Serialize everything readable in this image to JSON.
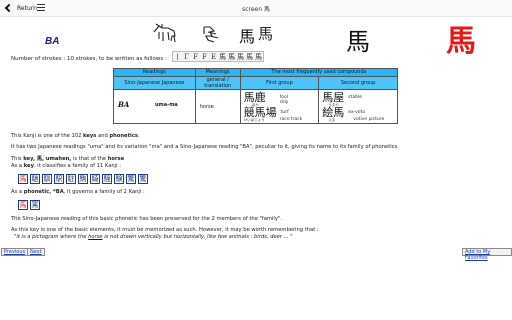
{
  "header": {
    "back_label": "Return",
    "title": "screen 馬"
  },
  "hero": {
    "reading": "BA",
    "stroke_order": [
      "丨",
      "Γ",
      "F",
      "F",
      "E",
      "馬",
      "馬",
      "馬",
      "馬",
      "馬"
    ],
    "kanji_old_1": "馬",
    "kanji_old_2": "馬",
    "kanji_display_black": "馬",
    "kanji_display_red": "馬"
  },
  "strokes_text": "Number of strokes : 10 strokes, to be written as follows :",
  "table": {
    "headers": {
      "readings": "Readings",
      "meanings": "Meanings",
      "compounds": "The most frequently used compounds"
    },
    "subheaders": {
      "readings": "Sino-Japanese    Japanese",
      "meanings": "general / translation",
      "first_group": "First group",
      "second_group": "Second group"
    },
    "row": {
      "sino": "BA",
      "japanese": "uma-ma",
      "meaning": "horse",
      "first_group": [
        {
          "kanji": "馬鹿",
          "meaning": "fool",
          "reading": "ばか"
        },
        {
          "kanji": "",
          "meaning": "silly",
          "reading": ""
        },
        {
          "kanji": "競馬場",
          "meaning": "turf",
          "reading": "けいばじょう"
        },
        {
          "kanji": "",
          "meaning": "race track",
          "reading": ""
        }
      ],
      "second_group": [
        {
          "kanji": "馬屋",
          "meaning": "stable",
          "reading": "うまや"
        },
        {
          "kanji": "絵馬",
          "meaning": "ex-voto",
          "reading": "えま"
        },
        {
          "kanji": "",
          "meaning": "votive picture",
          "reading": ""
        }
      ]
    }
  },
  "body": {
    "p1_pre": "This Kanji is one of the 102 ",
    "p1_keys": "keys",
    "p1_mid": " and ",
    "p1_phon": "phonetics",
    "p1_post": ".",
    "p2": "It has two Japanese readings \"uma\" and its variation \"ma\" and a Sino-Japanese reading \"BA\", peculiar to it, giving its name to its family of phonetics.",
    "p3_pre": "This ",
    "p3_key": "key, 馬, umahen,",
    "p3_mid": " is that of the ",
    "p3_horse": "horse",
    "p4_pre": "As a ",
    "p4_key": "key",
    "p4_post": ", it classifies a family of 11 Kanji :",
    "key_family": [
      "馬",
      "馳",
      "馴",
      "駅",
      "駐",
      "駒",
      "騎",
      "騒",
      "験",
      "驚",
      "驚"
    ],
    "p5_pre": "As a ",
    "p5_phon": "phonetic, *BA",
    "p5_post": ", it governs a family of 2 Kanji :",
    "phon_family": [
      "馬",
      "罵"
    ],
    "p6": "The Sino-Japanese reading of this basic phonetic has been preserved for the 2 members of the \"family\".",
    "p7": "As this key is one of the basic elements, it must be memorized as such. However, it may be worth remembering that :",
    "p8_pre": "\"it is a pictogram where the ",
    "p8_horse": "horse",
    "p8_post": " is not drawn vertically but horizontally, like few animals : birds, deer ... \""
  },
  "nav": {
    "previous": "Previous",
    "next": "Next",
    "favorites": "Add to My Favorites"
  },
  "colors": {
    "accent_red": "#e21a1a",
    "table_header": "#29b6f6",
    "link_blue": "#1a3fa6"
  }
}
